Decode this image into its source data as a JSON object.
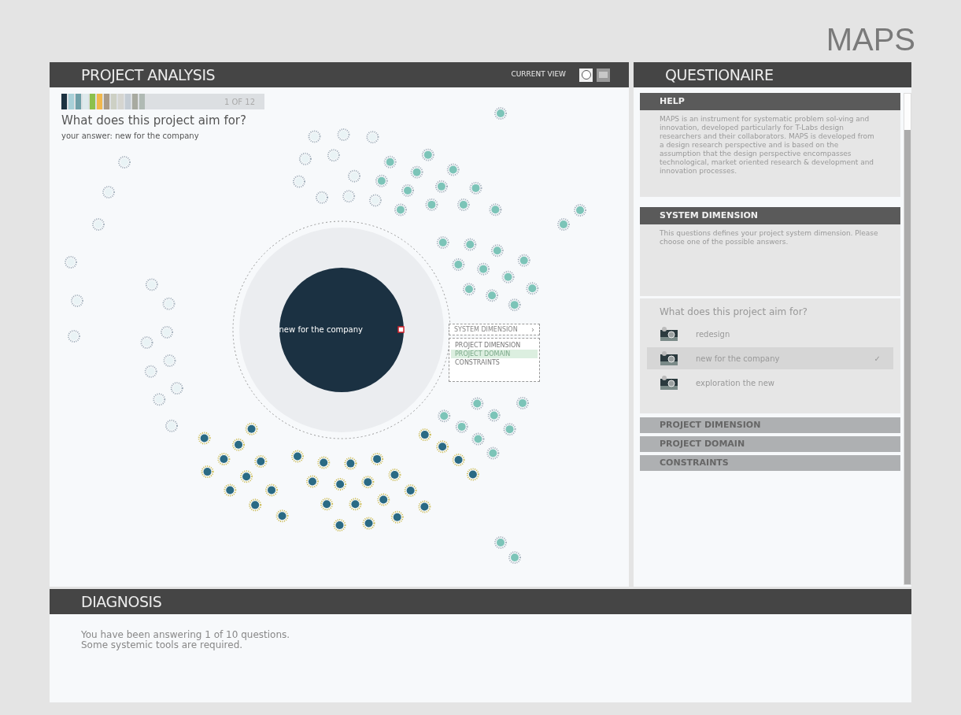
{
  "app_title": "MAPS",
  "analysis": {
    "title": "PROJECT ANALYSIS",
    "view_label": "CURRENT VIEW",
    "views": [
      {
        "kind": "circle",
        "selected": true
      },
      {
        "kind": "list",
        "selected": false
      }
    ],
    "swatches": [
      {
        "color": "#1c3140"
      },
      {
        "color": "#a8d0d8"
      },
      {
        "color": "#6fa0a8"
      },
      {
        "color": "#dde9ec"
      },
      {
        "color": "#8cc04c"
      },
      {
        "color": "#f2b84c"
      },
      {
        "color": "#a89a88"
      },
      {
        "color": "#cdd0c4"
      },
      {
        "color": "#d5d5d0"
      },
      {
        "color": "#c4ccd4"
      },
      {
        "color": "#a8aaa0"
      },
      {
        "color": "#b0bab4"
      }
    ],
    "counter": "1 OF 12",
    "question": "What does this project aim for?",
    "answer": "your answer: new for the company",
    "center_label": "new for the company",
    "popup": {
      "title": "SYSTEM DIMENSION",
      "arrow": "›",
      "items": [
        {
          "label": "PROJECT DIMENSION",
          "selected": false
        },
        {
          "label": "PROJECT DOMAIN",
          "selected": true
        },
        {
          "label": "CONSTRAINTS",
          "selected": false
        }
      ]
    }
  },
  "questionaire": {
    "title": "QUESTIONAIRE",
    "help": {
      "title": "HELP",
      "text": "MAPS is an instrument for systematic problem sol-ving and innovation, developed particularly for T-Labs design researchers and their collaborators. MAPS is developed from a design research perspective and is based on the assumption that the design perspective encompasses technological, market oriented research & development and innovation processes."
    },
    "system": {
      "title": "SYSTEM DIMENSION",
      "text": "This questions defines your project system dimension. Please choose one of the possible answers."
    },
    "question": "What does this project aim for?",
    "check_mark": "✓",
    "answers": [
      {
        "label": "redesign",
        "selected": false
      },
      {
        "label": "new for the company",
        "selected": true
      },
      {
        "label": "exploration the new",
        "selected": false
      }
    ],
    "sections": [
      {
        "title": "PROJECT DIMENSION"
      },
      {
        "title": "PROJECT DOMAIN"
      },
      {
        "title": "CONSTRAINTS"
      }
    ]
  },
  "diagnosis": {
    "title": "DIAGNOSIS",
    "lines": [
      "You have been answering 1 of 10 questions.",
      "Some systemic tools are required."
    ]
  }
}
